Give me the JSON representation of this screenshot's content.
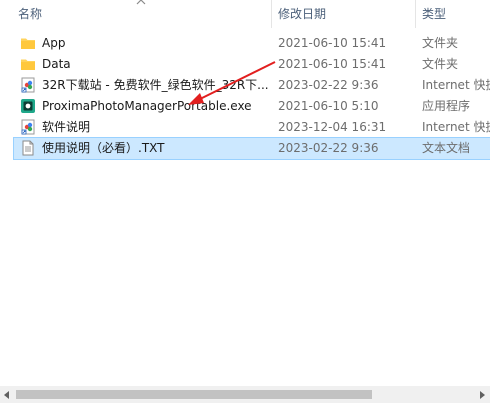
{
  "header": {
    "name_label": "名称",
    "date_label": "修改日期",
    "type_label": "类型"
  },
  "files": [
    {
      "name": "App",
      "date": "2021-06-10 15:41",
      "type": "文件夹",
      "icon": "folder-icon"
    },
    {
      "name": "Data",
      "date": "2021-06-10 15:41",
      "type": "文件夹",
      "icon": "folder-icon"
    },
    {
      "name": "32R下载站 - 免费软件_绿色软件_32R下...",
      "date": "2023-02-22 9:36",
      "type": "Internet 快捷",
      "icon": "internet-shortcut-icon"
    },
    {
      "name": "ProximaPhotoManagerPortable.exe",
      "date": "2021-06-10 5:10",
      "type": "应用程序",
      "icon": "app-exe-icon"
    },
    {
      "name": "软件说明",
      "date": "2023-12-04 16:31",
      "type": "Internet 快捷",
      "icon": "internet-shortcut-icon"
    },
    {
      "name": "使用说明（必看）.TXT",
      "date": "2023-02-22 9:36",
      "type": "文本文档",
      "icon": "text-document-icon"
    }
  ],
  "selected_index": 5,
  "colors": {
    "selection": "#cce8ff",
    "header_text": "#4c607a",
    "annotation_arrow": "#e21f1f"
  }
}
